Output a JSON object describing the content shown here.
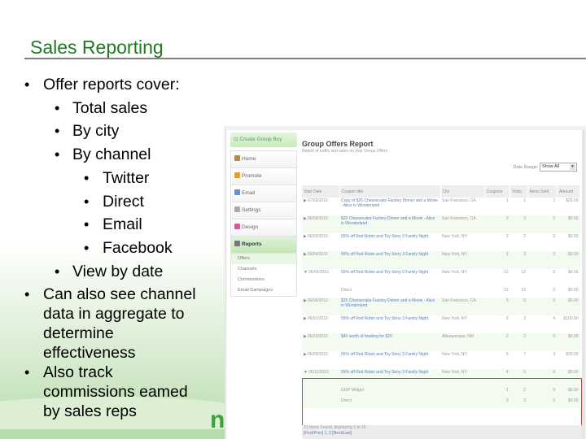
{
  "slide": {
    "title": "Sales Reporting",
    "bullets": [
      {
        "level": 1,
        "text": "Offer reports cover:"
      },
      {
        "level": 2,
        "text": "Total sales"
      },
      {
        "level": 2,
        "text": "By city"
      },
      {
        "level": 2,
        "text": "By channel"
      },
      {
        "level": 3,
        "text": "Twitter"
      },
      {
        "level": 3,
        "text": "Direct"
      },
      {
        "level": 3,
        "text": "Email"
      },
      {
        "level": 3,
        "text": "Facebook"
      },
      {
        "level": 2,
        "text": "View by date"
      },
      {
        "level": 1,
        "text": "Can also see channel",
        "cont": [
          "data in aggregate to",
          "determine",
          "effectiveness"
        ]
      },
      {
        "level": 1,
        "text": "Also track",
        "cont": [
          "commissions eamed",
          "by sales reps"
        ]
      }
    ],
    "logo_fragment": "ni",
    "bullet_glyph": "•"
  },
  "app": {
    "create_button": "Create Group Buy",
    "nav": [
      {
        "label": "Home",
        "icon": "home-icon",
        "color": "#b08a4a"
      },
      {
        "label": "Promote",
        "icon": "megaphone-icon",
        "color": "#e0a030"
      },
      {
        "label": "Email",
        "icon": "envelope-icon",
        "color": "#6a8fcf"
      },
      {
        "label": "Settings",
        "icon": "gear-icon",
        "color": "#aaaaaa"
      },
      {
        "label": "Design",
        "icon": "palette-icon",
        "color": "#d45aa0"
      },
      {
        "label": "Reports",
        "icon": "report-icon",
        "color": "#777777",
        "active": true
      }
    ],
    "subnav": [
      "Offers",
      "Channels",
      "Commissions",
      "Email Campaigns"
    ],
    "report": {
      "title": "Group Offers Report",
      "subtitle": "Report of traffic and sales on your Group Offers",
      "date_range_label": "Date Range:",
      "date_range_value": "Show All",
      "columns": [
        "Start Date",
        "Coupon title",
        "City",
        "Coupons",
        "Visits",
        "Items Sold",
        "Amount"
      ],
      "rows": [
        {
          "type": "row",
          "expand": "▶",
          "date": "07/03/2010",
          "title": "Copy of $25 Cheesecake Factory Dinner and a Movie - Alice in Wonderland",
          "city": "San Francisco, CA",
          "coupons": "1",
          "visits": "1",
          "items": "1",
          "amount": "$25.00"
        },
        {
          "type": "row",
          "expand": "▶",
          "date": "06/08/2010",
          "title": "$25 Cheesecake Factory Dinner and a Movie - Alice in Wonderland",
          "city": "San Francisco, CA",
          "coupons": "3",
          "visits": "3",
          "items": "0",
          "amount": "$0.00",
          "alt": true
        },
        {
          "type": "row",
          "expand": "▶",
          "date": "06/03/2010",
          "title": "55% off Red Robin and Toy Story 3 Family Night",
          "city": "New York, NY",
          "coupons": "2",
          "visits": "2",
          "items": "0",
          "amount": "$0.00"
        },
        {
          "type": "row",
          "expand": "▶",
          "date": "06/04/2010",
          "title": "55% off Red Robin and Toy Story 3 Family Night",
          "city": "New York, NY",
          "coupons": "2",
          "visits": "3",
          "items": "0",
          "amount": "$0.00",
          "alt": true
        },
        {
          "type": "row",
          "expand": "▼",
          "date": "06/09/2010",
          "title": "55% off Red Robin and Toy Story 3 Family Night",
          "city": "New York, NY",
          "coupons": "12",
          "visits": "12",
          "items": "0",
          "amount": "$0.00"
        },
        {
          "type": "sub",
          "title": "Direct",
          "coupons": "12",
          "visits": "12",
          "items": "0",
          "amount": "$0.00"
        },
        {
          "type": "row",
          "expand": "▶",
          "date": "06/06/2010",
          "title": "$25 Cheesecake Factory Dinner and a Movie - Alice in Wonderland",
          "city": "San Francisco, CA",
          "coupons": "5",
          "visits": "5",
          "items": "0",
          "amount": "$0.00",
          "alt": true
        },
        {
          "type": "row",
          "expand": "▶",
          "date": "06/01/2010",
          "title": "55% off Red Robin and Toy Story 3 Family Night",
          "city": "New York, NY",
          "coupons": "2",
          "visits": "3",
          "items": "4",
          "amount": "$100.00"
        },
        {
          "type": "row",
          "expand": "▶",
          "date": "06/23/2010",
          "title": "$40 worth of bowling for $20",
          "city": "Albuquerque, NM",
          "coupons": "2",
          "visits": "2",
          "items": "0",
          "amount": "$0.00",
          "alt": true
        },
        {
          "type": "row",
          "expand": "▶",
          "date": "06/09/2010",
          "title": "55% off Red Robin and Toy Story 3 Family Night",
          "city": "New York, NY",
          "coupons": "5",
          "visits": "7",
          "items": "3",
          "amount": "$20.00"
        },
        {
          "type": "row",
          "expand": "▼",
          "date": "06/11/2010",
          "title": "55% off Red Robin and Toy Story 3 Family Night",
          "city": "New York, NY",
          "coupons": "4",
          "visits": "5",
          "items": "0",
          "amount": "$0.00",
          "alt": true
        },
        {
          "type": "sub",
          "title": "GGP Widget",
          "coupons": "1",
          "visits": "2",
          "items": "0",
          "amount": "$0.00",
          "alt": true
        },
        {
          "type": "sub",
          "title": "Direct",
          "coupons": "3",
          "visits": "3",
          "items": "0",
          "amount": "$0.00",
          "alt": true
        }
      ],
      "pager_info": "21 Items Found, displaying 1 to 10",
      "pager_links": "[First/Prev] 1, 2 [Next/Last]"
    }
  }
}
